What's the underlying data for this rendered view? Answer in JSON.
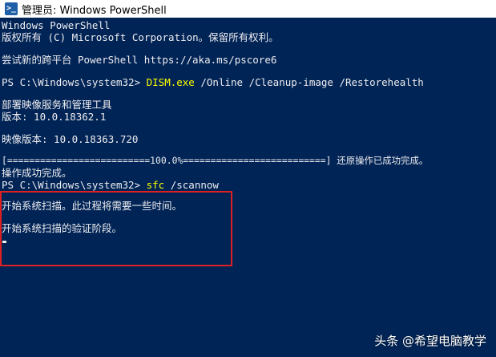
{
  "window": {
    "title": "管理员: Windows PowerShell",
    "icon": "powershell-icon",
    "icon_glyph": ">_"
  },
  "console": {
    "lines": [
      "Windows PowerShell",
      "版权所有 (C) Microsoft Corporation。保留所有权利。",
      "尝试新的跨平台 PowerShell https://aka.ms/pscore6",
      "PS C:\\Windows\\system32> ",
      "部署映像服务和管理工具",
      "版本: 10.0.18362.1",
      "映像版本: 10.0.18363.720",
      "[==========================100.0%==========================] 还原操作已成功完成。",
      "操作成功完成。",
      "PS C:\\Windows\\system32> ",
      "开始系统扫描。此过程将需要一些时间。",
      "开始系统扫描的验证阶段。"
    ],
    "command1": {
      "name": "DISM.exe",
      "args": " /Online /Cleanup-image /Restorehealth"
    },
    "command2": {
      "name": "sfc",
      "args": " /scannow"
    }
  },
  "colors": {
    "background": "#012456",
    "foreground": "#eeedf0",
    "command": "#ffff00",
    "highlight_border": "#e02020"
  },
  "watermark": "头条 @希望电脑教学"
}
